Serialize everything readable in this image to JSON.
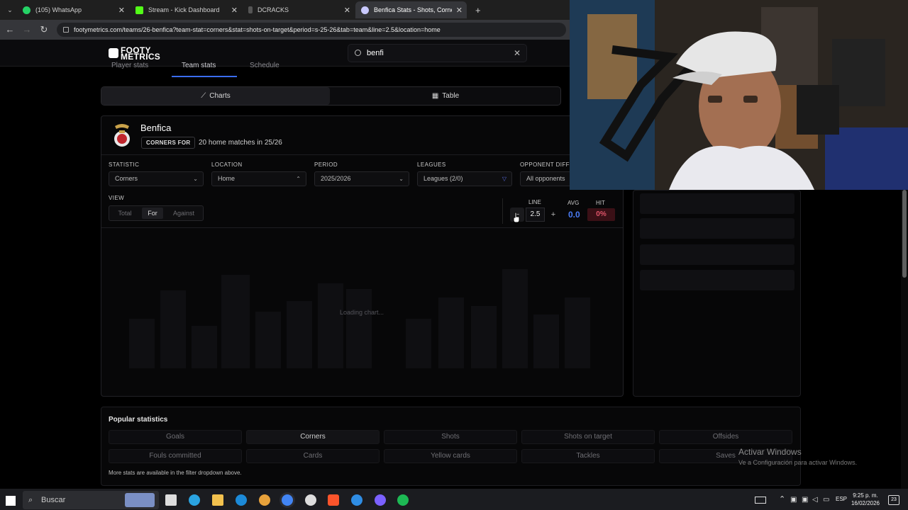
{
  "browser": {
    "tabs": [
      {
        "title": "(105) WhatsApp",
        "icon": "whatsapp-icon",
        "color": "#25d366"
      },
      {
        "title": "Stream - Kick Dashboard",
        "icon": "kick-icon",
        "color": "#53fc18"
      },
      {
        "title": "DCRACKS",
        "icon": "dcracks-icon",
        "color": "#444444"
      },
      {
        "title": "Benfica Stats - Shots, Corners &",
        "icon": "footymetrics-icon",
        "color": "#d8d8ff",
        "active": true
      }
    ],
    "new_tab": "+",
    "url": "footymetrics.com/teams/26-benfica?team-stat=corners&stat=shots-on-target&period=s-25-26&tab=team&line=2.5&location=home"
  },
  "header": {
    "logo_line1": "FOOTY",
    "logo_line2": "METRICS",
    "search_value": "benfi",
    "nav_tabs": [
      "Player stats",
      "Team stats",
      "Schedule"
    ]
  },
  "view_toggle": {
    "charts": "Charts",
    "table": "Table"
  },
  "team": {
    "name": "Benfica",
    "badge": "CORNERS FOR",
    "matches_text": "20 home matches in 25/26"
  },
  "filters": {
    "statistic": {
      "label": "STATISTIC",
      "value": "Corners"
    },
    "location": {
      "label": "LOCATION",
      "value": "Home"
    },
    "period": {
      "label": "PERIOD",
      "value": "2025/2026"
    },
    "leagues": {
      "label": "LEAGUES",
      "value": "Leagues (2/0)"
    },
    "opponent": {
      "label": "OPPONENT DIFF",
      "value": "All opponents"
    }
  },
  "view": {
    "label": "VIEW",
    "options": [
      "Total",
      "For",
      "Against"
    ],
    "selected": "For"
  },
  "line": {
    "label": "LINE",
    "value": "2.5",
    "minus": "−",
    "plus": "+"
  },
  "avg": {
    "label": "AVG",
    "value": "0.0",
    "color": "#4a7cf5"
  },
  "hit": {
    "label": "HIT",
    "value": "0%",
    "color": "#e0556a"
  },
  "chart": {
    "loading": "Loading chart..."
  },
  "popular": {
    "title": "Popular statistics",
    "items": [
      "Goals",
      "Corners",
      "Shots",
      "Shots on target",
      "Offsides",
      "Fouls committed",
      "Cards",
      "Yellow cards",
      "Tackles",
      "Saves"
    ],
    "selected": "Corners",
    "note": "More stats are available in the filter dropdown above."
  },
  "watermark": {
    "line1": "Activar Windows",
    "line2": "Ve a Configuración para activar Windows."
  },
  "taskbar": {
    "search": "Buscar",
    "lang": "ESP",
    "time": "9:25 p. m.",
    "date": "16/02/2026",
    "notifications": "23"
  }
}
